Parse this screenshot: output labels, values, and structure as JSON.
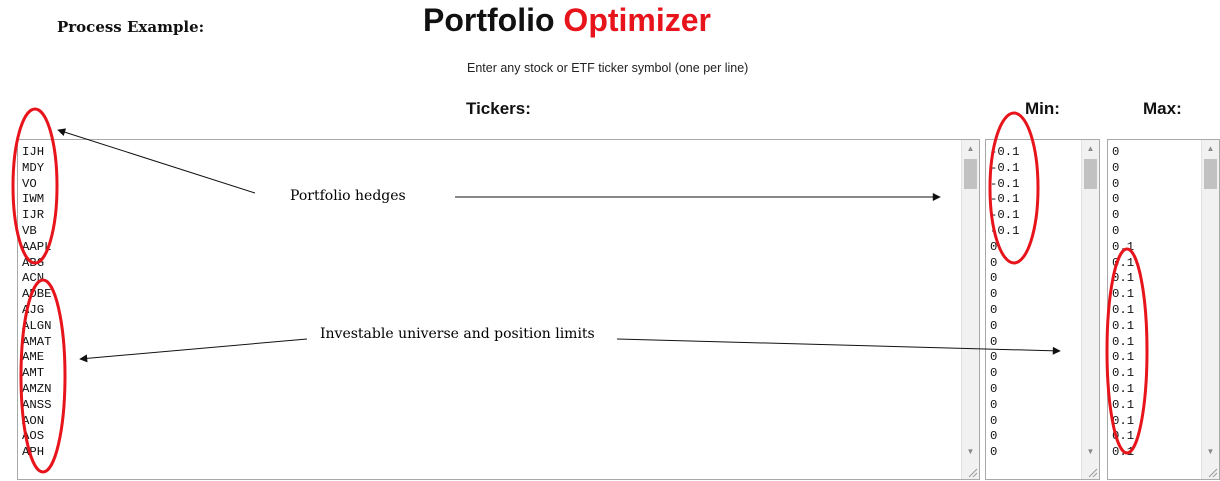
{
  "header": {
    "process_label": "Process Example:",
    "title_part1": "Portfolio",
    "title_part2": "Optimizer",
    "subtitle": "Enter any stock or ETF ticker symbol (one per line)"
  },
  "columns": {
    "tickers_label": "Tickers:",
    "min_label": "Min:",
    "max_label": "Max:"
  },
  "tickers": [
    "IJH",
    "MDY",
    "VO",
    "IWM",
    "IJR",
    "VB",
    "AAPL",
    "ABG",
    "ACN",
    "ADBE",
    "AJG",
    "ALGN",
    "AMAT",
    "AME",
    "AMT",
    "AMZN",
    "ANSS",
    "AON",
    "AOS",
    "APH"
  ],
  "min_values": [
    "-0.1",
    "-0.1",
    "-0.1",
    "-0.1",
    "-0.1",
    "-0.1",
    "0",
    "0",
    "0",
    "0",
    "0",
    "0",
    "0",
    "0",
    "0",
    "0",
    "0",
    "0",
    "0",
    "0"
  ],
  "max_values": [
    "0",
    "0",
    "0",
    "0",
    "0",
    "0",
    "0.1",
    "0.1",
    "0.1",
    "0.1",
    "0.1",
    "0.1",
    "0.1",
    "0.1",
    "0.1",
    "0.1",
    "0.1",
    "0.1",
    "0.1",
    "0.1"
  ],
  "annotations": {
    "hedges": "Portfolio hedges",
    "universe": "Investable universe and position limits"
  },
  "colors": {
    "title_accent": "#e8141b",
    "circle": "#e8141b"
  },
  "icons": [
    "scroll-up-icon",
    "scroll-down-icon",
    "resize-grip-icon"
  ]
}
